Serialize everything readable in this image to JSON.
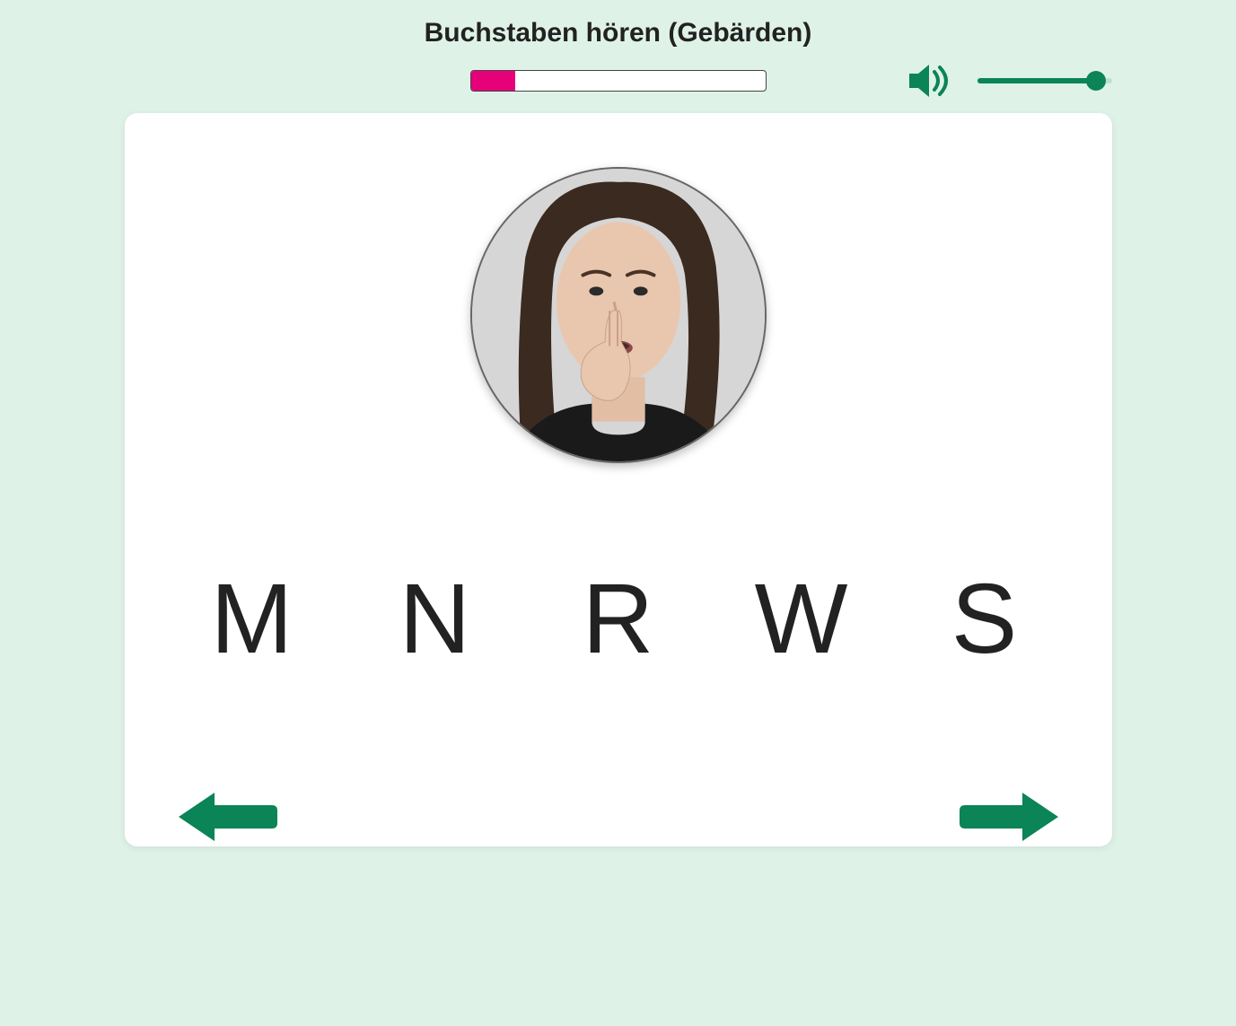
{
  "title": "Buchstaben hören (Gebärden)",
  "progress_percent": 15,
  "volume_percent": 88,
  "gesture": {
    "alt": "sign-language-gesture"
  },
  "options": [
    "M",
    "N",
    "R",
    "W",
    "S"
  ],
  "colors": {
    "accent": "#0b8457",
    "progress_fill": "#e6007a",
    "page_bg": "#dff2e8"
  }
}
